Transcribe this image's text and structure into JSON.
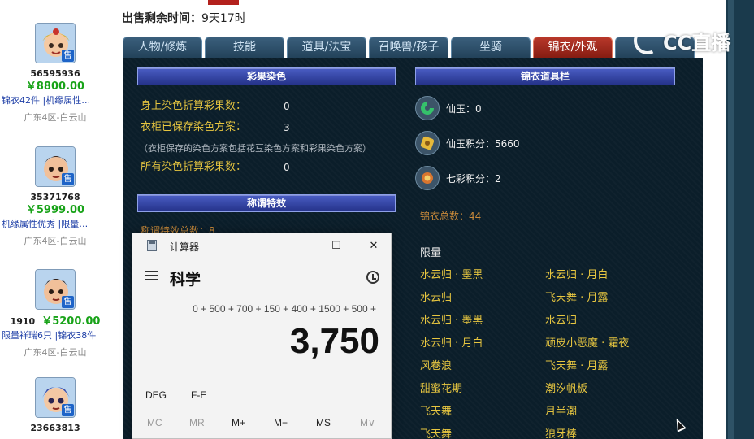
{
  "sale": {
    "label": "出售剩余时间：",
    "value": "9天17时"
  },
  "tabs": [
    "人物/修炼",
    "技能",
    "道具/法宝",
    "召唤兽/孩子",
    "坐骑",
    "锦衣/外观"
  ],
  "listings": [
    {
      "id": "56595936",
      "price": "￥8800.00",
      "tags": "锦衣42件 |机缘属性…",
      "server": "广东4区-白云山",
      "badge": "售"
    },
    {
      "id": "35371768",
      "price": "￥5999.00",
      "tags": "机缘属性优秀 |限量…",
      "server": "广东4区-白云山",
      "badge": "售"
    },
    {
      "id": "1910",
      "price": "￥5200.00",
      "tags": "限量祥瑞6只 |锦衣38件",
      "server": "广东4区-白云山",
      "badge": "售"
    },
    {
      "id": "23663813",
      "price": "",
      "tags": "",
      "server": "",
      "badge": "售"
    }
  ],
  "dye_section": {
    "header": "彩果染色",
    "rows": [
      {
        "label": "身上染色折算彩果数：",
        "value": "0"
      },
      {
        "label": "衣柜已保存染色方案：",
        "value": "3"
      },
      {
        "label": "所有染色折算彩果数：",
        "value": "0"
      }
    ],
    "note": "（衣柜保存的染色方案包括花豆染色方案和彩果染色方案）"
  },
  "title_section": {
    "header": "称谓特效",
    "partial": "称谓特效总数：8"
  },
  "costume_section": {
    "header": "锦衣道具栏",
    "items": [
      {
        "icon": "jade-icon",
        "label": "仙玉：",
        "value": "0"
      },
      {
        "icon": "jade-points-icon",
        "label": "仙玉积分：",
        "value": "5660"
      },
      {
        "icon": "rainbow-points-icon",
        "label": "七彩积分：",
        "value": "2"
      }
    ],
    "total": "锦衣总数：44",
    "limited_label": "限量",
    "grid_left": [
      "水云归 · 墨黑",
      "水云归",
      "水云归 · 墨黑",
      "水云归 · 月白",
      "风卷浪",
      "甜蜜花期",
      "飞天舞",
      "飞天舞"
    ],
    "grid_right": [
      "水云归 · 月白",
      "飞天舞 · 月露",
      "水云归",
      "顽皮小恶魔 · 霜夜",
      "飞天舞 · 月露",
      "潮汐帆板",
      "月半潮",
      "狼牙棒"
    ]
  },
  "calculator": {
    "window_title": "计算器",
    "mode": "科学",
    "expression": "0 + 500 + 700 + 150 + 400 + 1500 + 500 +",
    "result": "3,750",
    "keys_row1": [
      "DEG",
      "F-E"
    ],
    "memory_keys": [
      "MC",
      "MR",
      "M+",
      "M−",
      "MS",
      "M∨"
    ],
    "window_buttons": [
      "—",
      "☐",
      "✕"
    ]
  },
  "watermark": {
    "text": "CC直播"
  },
  "colors": {
    "panel_bg": "#0b1e2a",
    "accent_gold": "#e7c640",
    "active_tab": "#b8382a",
    "price_green": "#19a319"
  }
}
